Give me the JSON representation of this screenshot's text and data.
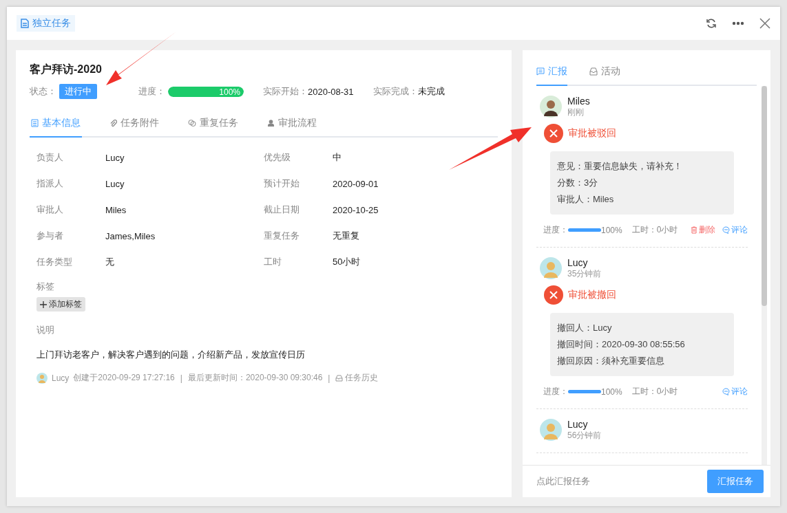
{
  "header": {
    "badge": "独立任务"
  },
  "task": {
    "title": "客户拜访-2020",
    "status_label": "状态：",
    "status": "进行中",
    "progress_label": "进度：",
    "progress": {
      "level": 1,
      "reading": "100%"
    },
    "meta": [
      {
        "label": "实际开始：",
        "value": "2020-08-31"
      },
      {
        "label": "实际完成：",
        "value": "未完成"
      }
    ]
  },
  "tabs": [
    {
      "label": "基本信息",
      "selected": true
    },
    {
      "label": "任务附件",
      "selected": false
    },
    {
      "label": "重复任务",
      "selected": false
    },
    {
      "label": "审批流程",
      "selected": false
    }
  ],
  "fields": [
    {
      "label": "负责人",
      "value": "Lucy"
    },
    {
      "label": "优先级",
      "value": "中"
    },
    {
      "label": "指派人",
      "value": "Lucy"
    },
    {
      "label": "预计开始",
      "value": "2020-09-01"
    },
    {
      "label": "审批人",
      "value": "Miles"
    },
    {
      "label": "截止日期",
      "value": "2020-10-25"
    },
    {
      "label": "参与者",
      "value": "James,Miles"
    },
    {
      "label": "重复任务",
      "value": "无重复"
    },
    {
      "label": "任务类型",
      "value": "无"
    },
    {
      "label": "工时",
      "value": "50小时"
    }
  ],
  "tags": {
    "label": "标签",
    "add_button": "添加标签"
  },
  "description": {
    "label": "说明",
    "text": "上门拜访老客户，解决客户遇到的问题，介绍新产品，发放宣传日历"
  },
  "footer": {
    "user": "Lucy",
    "created": "创建于2020-09-29 17:27:16",
    "updated": "最后更新时间：2020-09-30 09:30:46",
    "history": "任务历史",
    "separator": "|"
  },
  "side_tabs": [
    {
      "label": "汇报",
      "selected": true
    },
    {
      "label": "活动",
      "selected": false
    }
  ],
  "reports": [
    {
      "user": "Miles",
      "time": "刚刚",
      "status": "审批被驳回",
      "details": [
        "意见：重要信息缺失，请补充！",
        "分数：3分",
        "审批人：Miles"
      ],
      "progress_label": "进度：",
      "progress": {
        "level": 1,
        "reading": "100%"
      },
      "hours": "工时：0小时",
      "delete": "删除",
      "comment": "评论"
    },
    {
      "user": "Lucy",
      "time": "35分钟前",
      "status": "审批被撤回",
      "details": [
        "撤回人：Lucy",
        "撤回时间：2020-09-30 08:55:56",
        "撤回原因：须补充重要信息"
      ],
      "progress_label": "进度：",
      "progress": {
        "level": 1,
        "reading": "100%"
      },
      "hours": "工时：0小时",
      "comment": "评论"
    },
    {
      "user": "Lucy",
      "time": "56分钟前"
    }
  ],
  "report_bar": {
    "hint": "点此汇报任务",
    "button": "汇报任务"
  }
}
